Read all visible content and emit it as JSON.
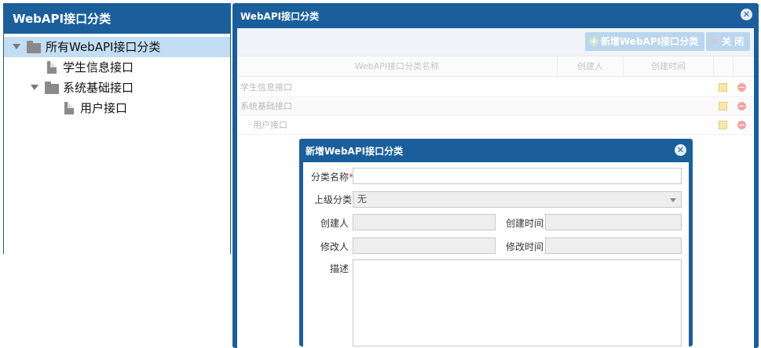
{
  "left_panel": {
    "title": "WebAPI接口分类",
    "tree": [
      {
        "label": "所有WebAPI接口分类",
        "type": "folder",
        "expanded": true,
        "selected": true,
        "level": 0
      },
      {
        "label": "学生信息接口",
        "type": "file",
        "level": 1
      },
      {
        "label": "系统基础接口",
        "type": "folder",
        "expanded": true,
        "level": 1
      },
      {
        "label": "用户接口",
        "type": "file",
        "level": 2
      }
    ]
  },
  "main_dialog": {
    "title": "WebAPI接口分类",
    "close_icon": "close-icon",
    "toolbar": {
      "add_label": "新增WebAPI接口分类",
      "close_label": "关 闭"
    },
    "grid": {
      "columns": [
        "WebAPI接口分类名称",
        "创建人",
        "创建时间"
      ],
      "rows": [
        {
          "name": "学生信息接口",
          "creator": "",
          "created": ""
        },
        {
          "name": "系统基础接口",
          "creator": "",
          "created": ""
        },
        {
          "name": "用户接口",
          "creator": "",
          "created": ""
        }
      ]
    }
  },
  "inner_dialog": {
    "title": "新增WebAPI接口分类",
    "fields": {
      "name_label": "分类名称",
      "name_required": "*",
      "name_value": "",
      "parent_label": "上级分类",
      "parent_value": "无",
      "creator_label": "创建人",
      "creator_value": "",
      "created_label": "创建时间",
      "created_value": "",
      "modifier_label": "修改人",
      "modifier_value": "",
      "modified_label": "修改时间",
      "modified_value": "",
      "desc_label": "描述",
      "desc_value": ""
    }
  },
  "colors": {
    "accent": "#1a5f9c",
    "selected_row": "#c2ddf4",
    "button_disabled": "#b9d6ee"
  }
}
